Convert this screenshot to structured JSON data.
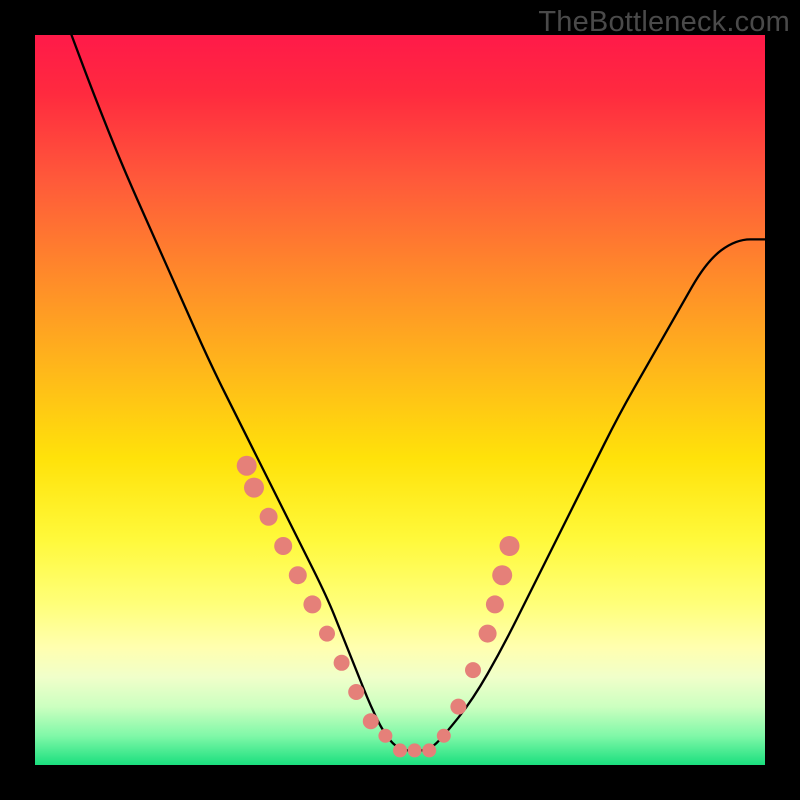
{
  "watermark": "TheBottleneck.com",
  "chart_data": {
    "type": "line",
    "title": "",
    "xlabel": "",
    "ylabel": "",
    "xlim": [
      0,
      100
    ],
    "ylim": [
      0,
      100
    ],
    "grid": false,
    "legend": false,
    "series": [
      {
        "name": "bottleneck-curve",
        "x": [
          5,
          8,
          12,
          16,
          20,
          24,
          28,
          32,
          36,
          40,
          42,
          44,
          46,
          48,
          50,
          52,
          54,
          56,
          60,
          64,
          68,
          72,
          76,
          80,
          84,
          88,
          92,
          96,
          100
        ],
        "y": [
          100,
          92,
          82,
          73,
          64,
          55,
          47,
          39,
          31,
          23,
          18,
          13,
          8,
          4,
          2,
          2,
          2,
          4,
          9,
          16,
          24,
          32,
          40,
          48,
          55,
          62,
          69,
          72,
          72
        ]
      }
    ],
    "markers": {
      "name": "highlight-dots",
      "x": [
        29,
        30,
        32,
        34,
        36,
        38,
        40,
        42,
        44,
        46,
        48,
        50,
        52,
        54,
        56,
        58,
        60,
        62,
        63,
        64,
        65
      ],
      "y": [
        41,
        38,
        34,
        30,
        26,
        22,
        18,
        14,
        10,
        6,
        4,
        2,
        2,
        2,
        4,
        8,
        13,
        18,
        22,
        26,
        30
      ],
      "radii": [
        10,
        10,
        9,
        9,
        9,
        9,
        8,
        8,
        8,
        8,
        7,
        7,
        7,
        7,
        7,
        8,
        8,
        9,
        9,
        10,
        10
      ]
    }
  }
}
